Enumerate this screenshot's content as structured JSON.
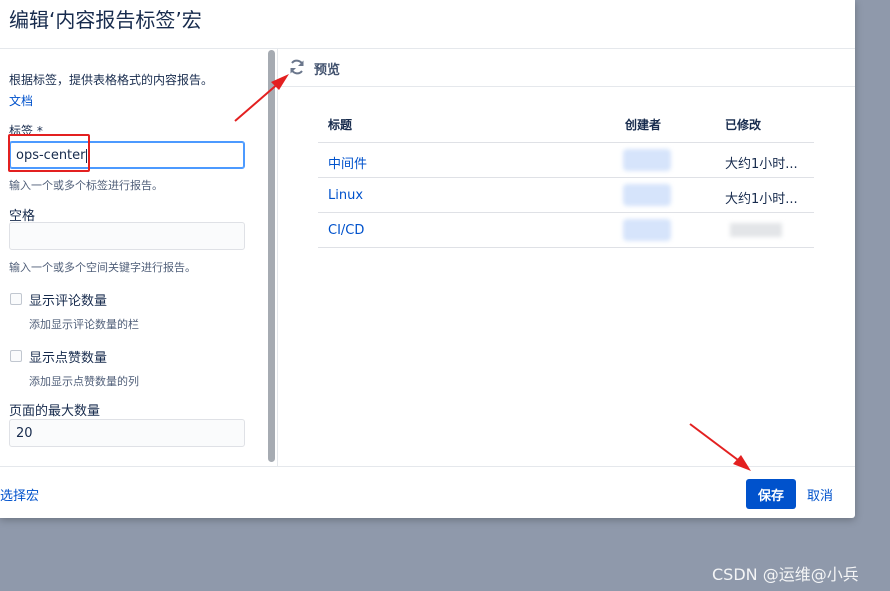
{
  "dialog": {
    "title": "编辑‘内容报告标签’宏"
  },
  "form": {
    "description": "根据标签，提供表格格式的内容报告。",
    "doc_link": "文档",
    "labels_field": {
      "label": "标签 *",
      "value": "ops-center",
      "hint": "输入一个或多个标签进行报告。"
    },
    "spaces_field": {
      "label": "空格",
      "value": "",
      "hint": "输入一个或多个空间关键字进行报告。"
    },
    "show_comments": {
      "label": "显示评论数量",
      "hint": "添加显示评论数量的栏"
    },
    "show_likes": {
      "label": "显示点赞数量",
      "hint": "添加显示点赞数量的列"
    },
    "max_pages": {
      "label": "页面的最大数量",
      "value": "20"
    }
  },
  "preview": {
    "label": "预览",
    "columns": [
      "标题",
      "创建者",
      "已修改"
    ],
    "rows": [
      {
        "title": "中间件",
        "modified": "大约1小时..."
      },
      {
        "title": "Linux",
        "modified": "大约1小时..."
      },
      {
        "title": "CI/CD",
        "modified": ""
      }
    ]
  },
  "footer": {
    "select_macro": "选择宏",
    "save": "保存",
    "cancel": "取消"
  },
  "watermark": "CSDN @运维@小兵",
  "colors": {
    "accent": "#0052cc",
    "annotation": "#e32020",
    "backdrop": "#8f99ab"
  }
}
